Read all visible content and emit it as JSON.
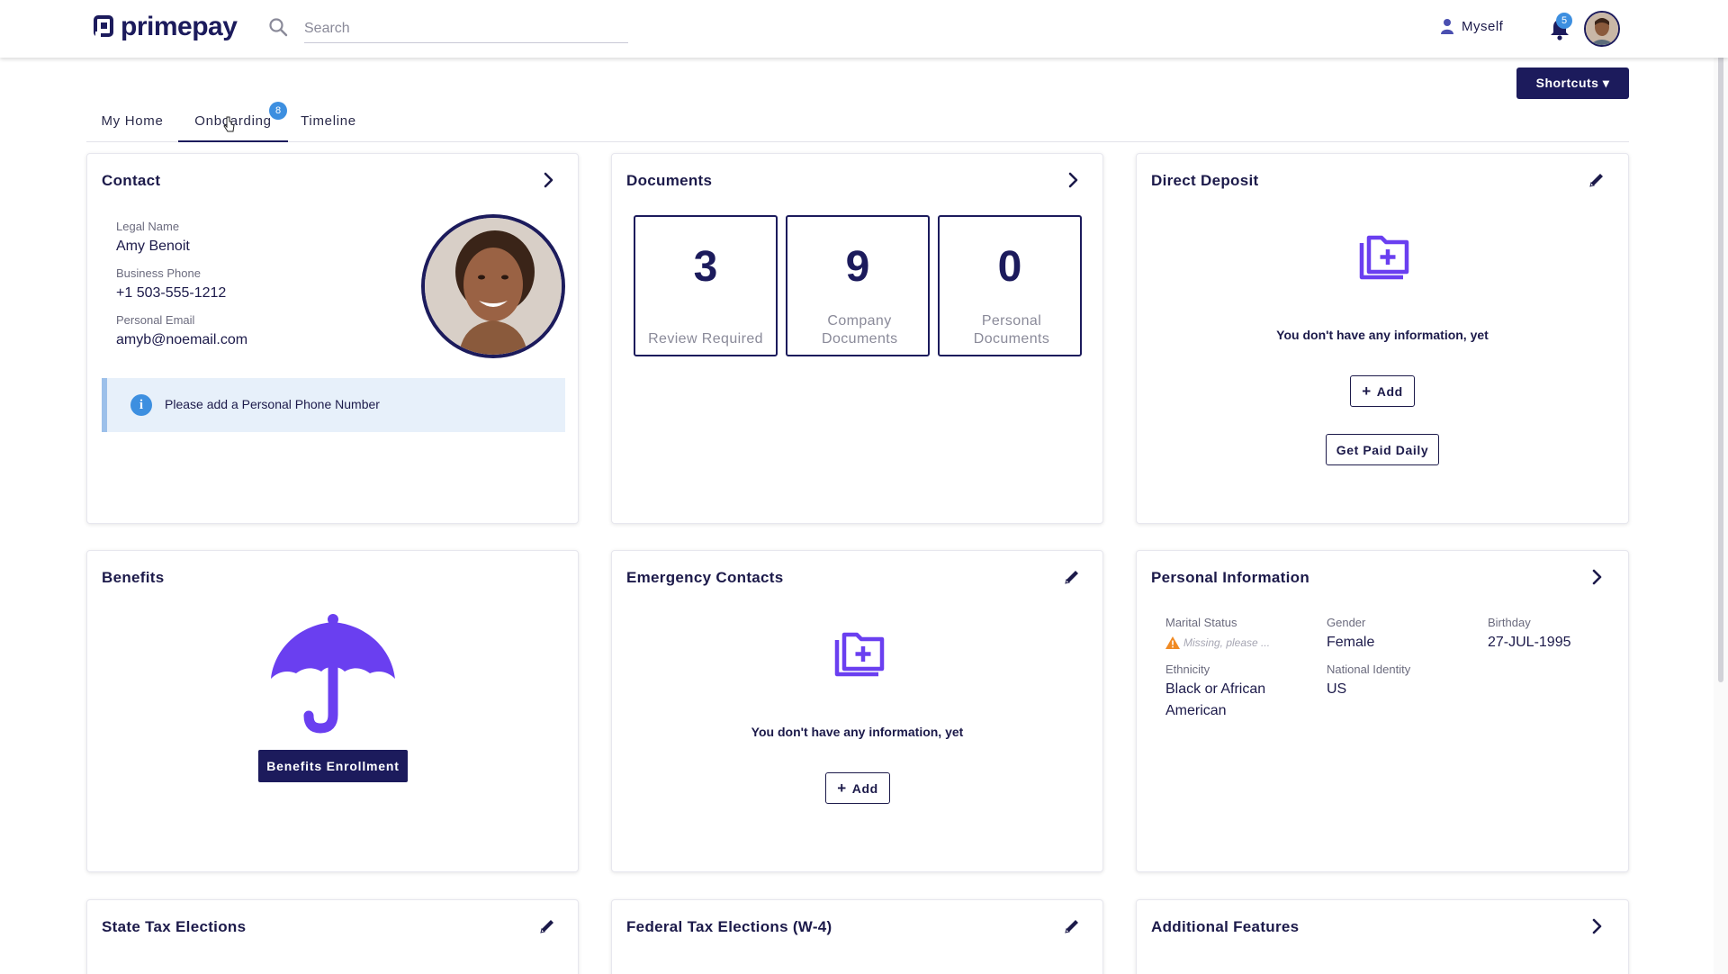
{
  "header": {
    "logo_text": "primepay",
    "search_placeholder": "Search",
    "user_label": "Myself",
    "notification_count": "5"
  },
  "shortcuts_label": "Shortcuts ▾",
  "tabs": [
    {
      "label": "My Home",
      "active": false
    },
    {
      "label": "Onboarding",
      "active": true,
      "badge": "8"
    },
    {
      "label": "Timeline",
      "active": false
    }
  ],
  "contact": {
    "title": "Contact",
    "legal_name_label": "Legal Name",
    "legal_name": "Amy Benoit",
    "business_phone_label": "Business Phone",
    "business_phone": "+1 503-555-1212",
    "personal_email_label": "Personal Email",
    "personal_email": "amyb@noemail.com",
    "info_message": "Please add a Personal Phone Number"
  },
  "documents": {
    "title": "Documents",
    "items": [
      {
        "count": "3",
        "label": "Review Required"
      },
      {
        "count": "9",
        "label": "Company Documents"
      },
      {
        "count": "0",
        "label": "Personal Documents"
      }
    ]
  },
  "direct_deposit": {
    "title": "Direct Deposit",
    "empty_text": "You don't have any information, yet",
    "add_label": "Add",
    "get_paid_daily_label": "Get Paid Daily"
  },
  "benefits": {
    "title": "Benefits",
    "enroll_label": "Benefits Enrollment"
  },
  "emergency_contacts": {
    "title": "Emergency Contacts",
    "empty_text": "You don't have any information, yet",
    "add_label": "Add"
  },
  "personal_info": {
    "title": "Personal Information",
    "marital_status_label": "Marital Status",
    "marital_status_value": "Missing, please ...",
    "gender_label": "Gender",
    "gender_value": "Female",
    "birthday_label": "Birthday",
    "birthday_value": "27-JUL-1995",
    "ethnicity_label": "Ethnicity",
    "ethnicity_line1": "Black or African",
    "ethnicity_line2": "American",
    "national_identity_label": "National Identity",
    "national_identity_value": "US"
  },
  "state_tax": {
    "title": "State Tax Elections"
  },
  "federal_tax": {
    "title": "Federal Tax Elections (W-4)"
  },
  "additional_features": {
    "title": "Additional Features"
  },
  "colors": {
    "brand_navy": "#1c1b5c",
    "accent_purple": "#6a3ff0",
    "badge_blue": "#3d8fe0",
    "warning_orange": "#f08a24"
  }
}
